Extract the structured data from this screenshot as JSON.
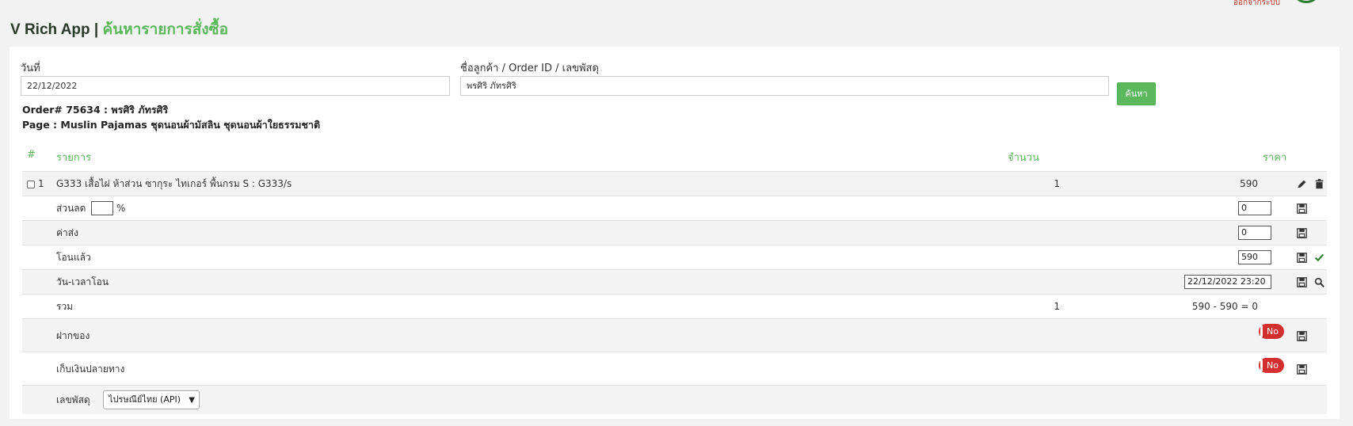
{
  "header": {
    "app_name": "V Rich App",
    "separator": "|",
    "page_title": "ค้นหารายการสั่งซื้อ",
    "top_right_text": "ออกจากระบบ"
  },
  "search": {
    "date_label": "วันที่",
    "date_value": "22/12/2022",
    "query_label": "ชื่อลูกค้า / Order ID / เลขพัสดุ",
    "query_value": "พรศิริ ภัทรศิริ",
    "button_label": "ค้นหา"
  },
  "order": {
    "order_line": "Order# 75634 : พรศิริ ภัทรศิริ",
    "page_line": "Page : Muslin Pajamas ชุดนอนผ้ามัสลิน ชุดนอนผ้าใยธรรมชาติ"
  },
  "table": {
    "headers": {
      "index": "#",
      "item": "รายการ",
      "qty": "จำนวน",
      "price": "ราคา"
    },
    "items": [
      {
        "index": "1",
        "name": "G333 เสื้อไผ่ ห้าส่วน ซากุระ ไทเกอร์ พื้นกรม S : G333/s",
        "qty": "1",
        "price": "590"
      }
    ],
    "discount": {
      "label": "ส่วนลด",
      "percent_value": "",
      "percent_suffix": "%",
      "amount": "0"
    },
    "shipping": {
      "label": "ค่าส่ง",
      "amount": "0"
    },
    "transferred": {
      "label": "โอนแล้ว",
      "amount": "590"
    },
    "transfer_datetime": {
      "label": "วัน-เวลาโอน",
      "value": "22/12/2022 23:20"
    },
    "total": {
      "label": "รวม",
      "qty": "1",
      "value": "590 - 590 = 0"
    },
    "deposit": {
      "label": "ฝากของ",
      "toggle": "No"
    },
    "cod": {
      "label": "เก็บเงินปลายทาง",
      "toggle": "No"
    },
    "tracking": {
      "label": "เลขพัสดุ",
      "carrier": "ไปรษณีย์ไทย (API)"
    }
  },
  "colors": {
    "accent": "#5cb85c",
    "toggle_off": "#d32f2f",
    "title_dark": "#2b3a2b"
  }
}
